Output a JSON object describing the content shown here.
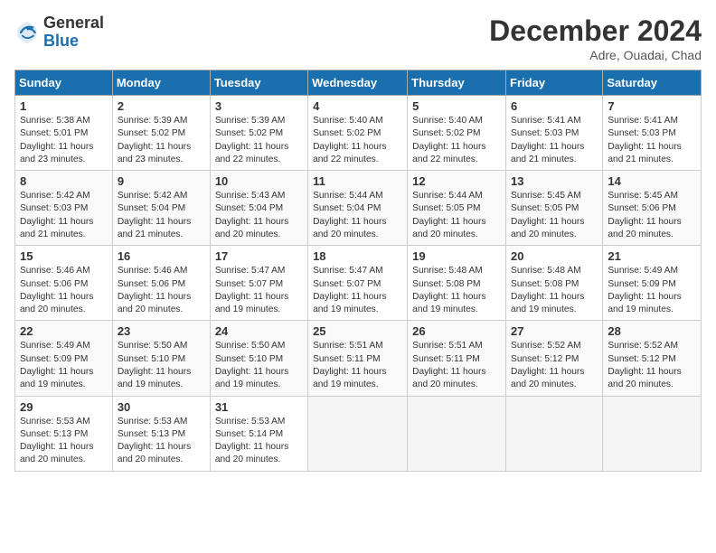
{
  "header": {
    "logo_general": "General",
    "logo_blue": "Blue",
    "month_title": "December 2024",
    "location": "Adre, Ouadai, Chad"
  },
  "days_of_week": [
    "Sunday",
    "Monday",
    "Tuesday",
    "Wednesday",
    "Thursday",
    "Friday",
    "Saturday"
  ],
  "weeks": [
    [
      {
        "day": 1,
        "info": "Sunrise: 5:38 AM\nSunset: 5:01 PM\nDaylight: 11 hours\nand 23 minutes."
      },
      {
        "day": 2,
        "info": "Sunrise: 5:39 AM\nSunset: 5:02 PM\nDaylight: 11 hours\nand 23 minutes."
      },
      {
        "day": 3,
        "info": "Sunrise: 5:39 AM\nSunset: 5:02 PM\nDaylight: 11 hours\nand 22 minutes."
      },
      {
        "day": 4,
        "info": "Sunrise: 5:40 AM\nSunset: 5:02 PM\nDaylight: 11 hours\nand 22 minutes."
      },
      {
        "day": 5,
        "info": "Sunrise: 5:40 AM\nSunset: 5:02 PM\nDaylight: 11 hours\nand 22 minutes."
      },
      {
        "day": 6,
        "info": "Sunrise: 5:41 AM\nSunset: 5:03 PM\nDaylight: 11 hours\nand 21 minutes."
      },
      {
        "day": 7,
        "info": "Sunrise: 5:41 AM\nSunset: 5:03 PM\nDaylight: 11 hours\nand 21 minutes."
      }
    ],
    [
      {
        "day": 8,
        "info": "Sunrise: 5:42 AM\nSunset: 5:03 PM\nDaylight: 11 hours\nand 21 minutes."
      },
      {
        "day": 9,
        "info": "Sunrise: 5:42 AM\nSunset: 5:04 PM\nDaylight: 11 hours\nand 21 minutes."
      },
      {
        "day": 10,
        "info": "Sunrise: 5:43 AM\nSunset: 5:04 PM\nDaylight: 11 hours\nand 20 minutes."
      },
      {
        "day": 11,
        "info": "Sunrise: 5:44 AM\nSunset: 5:04 PM\nDaylight: 11 hours\nand 20 minutes."
      },
      {
        "day": 12,
        "info": "Sunrise: 5:44 AM\nSunset: 5:05 PM\nDaylight: 11 hours\nand 20 minutes."
      },
      {
        "day": 13,
        "info": "Sunrise: 5:45 AM\nSunset: 5:05 PM\nDaylight: 11 hours\nand 20 minutes."
      },
      {
        "day": 14,
        "info": "Sunrise: 5:45 AM\nSunset: 5:06 PM\nDaylight: 11 hours\nand 20 minutes."
      }
    ],
    [
      {
        "day": 15,
        "info": "Sunrise: 5:46 AM\nSunset: 5:06 PM\nDaylight: 11 hours\nand 20 minutes."
      },
      {
        "day": 16,
        "info": "Sunrise: 5:46 AM\nSunset: 5:06 PM\nDaylight: 11 hours\nand 20 minutes."
      },
      {
        "day": 17,
        "info": "Sunrise: 5:47 AM\nSunset: 5:07 PM\nDaylight: 11 hours\nand 19 minutes."
      },
      {
        "day": 18,
        "info": "Sunrise: 5:47 AM\nSunset: 5:07 PM\nDaylight: 11 hours\nand 19 minutes."
      },
      {
        "day": 19,
        "info": "Sunrise: 5:48 AM\nSunset: 5:08 PM\nDaylight: 11 hours\nand 19 minutes."
      },
      {
        "day": 20,
        "info": "Sunrise: 5:48 AM\nSunset: 5:08 PM\nDaylight: 11 hours\nand 19 minutes."
      },
      {
        "day": 21,
        "info": "Sunrise: 5:49 AM\nSunset: 5:09 PM\nDaylight: 11 hours\nand 19 minutes."
      }
    ],
    [
      {
        "day": 22,
        "info": "Sunrise: 5:49 AM\nSunset: 5:09 PM\nDaylight: 11 hours\nand 19 minutes."
      },
      {
        "day": 23,
        "info": "Sunrise: 5:50 AM\nSunset: 5:10 PM\nDaylight: 11 hours\nand 19 minutes."
      },
      {
        "day": 24,
        "info": "Sunrise: 5:50 AM\nSunset: 5:10 PM\nDaylight: 11 hours\nand 19 minutes."
      },
      {
        "day": 25,
        "info": "Sunrise: 5:51 AM\nSunset: 5:11 PM\nDaylight: 11 hours\nand 19 minutes."
      },
      {
        "day": 26,
        "info": "Sunrise: 5:51 AM\nSunset: 5:11 PM\nDaylight: 11 hours\nand 20 minutes."
      },
      {
        "day": 27,
        "info": "Sunrise: 5:52 AM\nSunset: 5:12 PM\nDaylight: 11 hours\nand 20 minutes."
      },
      {
        "day": 28,
        "info": "Sunrise: 5:52 AM\nSunset: 5:12 PM\nDaylight: 11 hours\nand 20 minutes."
      }
    ],
    [
      {
        "day": 29,
        "info": "Sunrise: 5:53 AM\nSunset: 5:13 PM\nDaylight: 11 hours\nand 20 minutes."
      },
      {
        "day": 30,
        "info": "Sunrise: 5:53 AM\nSunset: 5:13 PM\nDaylight: 11 hours\nand 20 minutes."
      },
      {
        "day": 31,
        "info": "Sunrise: 5:53 AM\nSunset: 5:14 PM\nDaylight: 11 hours\nand 20 minutes."
      },
      null,
      null,
      null,
      null
    ]
  ]
}
